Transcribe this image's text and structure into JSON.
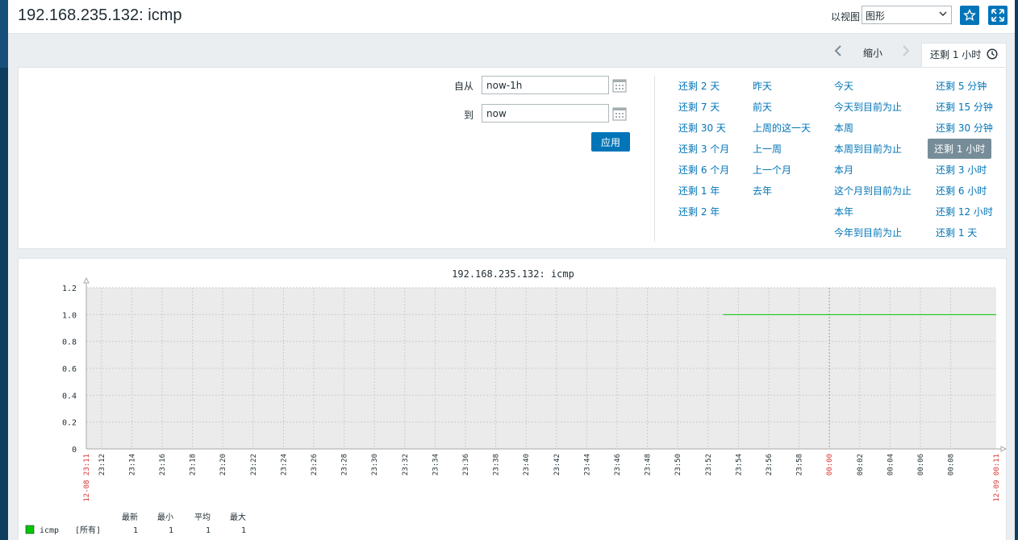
{
  "header": {
    "title": "192.168.235.132: icmp",
    "view_label": "以视图",
    "view_select_value": "图形"
  },
  "time_nav": {
    "zoom_out": "缩小",
    "active_tab": "还剩 1 小时"
  },
  "filter": {
    "from_label": "自从",
    "from_value": "now-1h",
    "to_label": "到",
    "to_value": "now",
    "apply_label": "应用"
  },
  "quick_ranges": {
    "col1": [
      "还剩 2 天",
      "还剩 7 天",
      "还剩 30 天",
      "还剩 3 个月",
      "还剩 6 个月",
      "还剩 1 年",
      "还剩 2 年"
    ],
    "col2": [
      "昨天",
      "前天",
      "上周的这一天",
      "上一周",
      "上一个月",
      "去年"
    ],
    "col3": [
      "今天",
      "今天到目前为止",
      "本周",
      "本周到目前为止",
      "本月",
      "这个月到目前为止",
      "本年",
      "今年到目前为止"
    ],
    "col4": [
      "还剩 5 分钟",
      "还剩 15 分钟",
      "还剩 30 分钟",
      "还剩 1 小时",
      "还剩 3 小时",
      "还剩 6 小时",
      "还剩 12 小时",
      "还剩 1 天"
    ],
    "selected": "还剩 1 小时"
  },
  "colors": {
    "accent": "#0275b8",
    "series": "#00c800",
    "red_label": "#dc3030"
  },
  "chart_data": {
    "type": "line",
    "title": "192.168.235.132:  icmp",
    "ylim": [
      0,
      1.2
    ],
    "y_ticks": [
      "0",
      "0.2",
      "0.4",
      "0.6",
      "0.8",
      "1.0",
      "1.2"
    ],
    "x_start_label": "12-08 23:11",
    "x_end_label": "12-09 00:11",
    "x_ticks": [
      "23:12",
      "23:14",
      "23:16",
      "23:18",
      "23:20",
      "23:22",
      "23:24",
      "23:26",
      "23:28",
      "23:30",
      "23:32",
      "23:34",
      "23:36",
      "23:38",
      "23:40",
      "23:42",
      "23:44",
      "23:46",
      "23:48",
      "23:50",
      "23:52",
      "23:54",
      "23:56",
      "23:58",
      "00:00",
      "00:02",
      "00:04",
      "00:06",
      "00:08"
    ],
    "red_ticks": [
      "00:00"
    ],
    "grid": true,
    "series": [
      {
        "name": "icmp",
        "x_from": "23:53",
        "x_to": "00:11",
        "value": 1
      }
    ],
    "legend": {
      "headers": [
        "最新",
        "最小",
        "平均",
        "最大"
      ],
      "items": [
        {
          "name": "icmp",
          "scope": "[所有]",
          "last": "1",
          "min": "1",
          "avg": "1",
          "max": "1"
        }
      ]
    }
  }
}
